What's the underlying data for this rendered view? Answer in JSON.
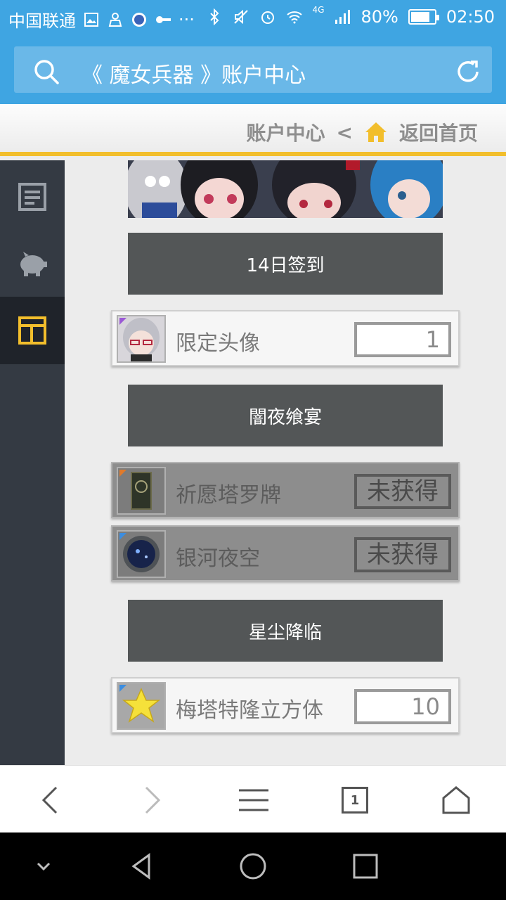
{
  "status_bar": {
    "carrier": "中国联通",
    "network": "4G",
    "battery_percent": "80%",
    "battery_level": 0.8,
    "time": "02:50"
  },
  "browser": {
    "page_title": "《 魔女兵器 》账户中心",
    "icons": [
      "search-icon",
      "refresh-icon"
    ]
  },
  "breadcrumb": {
    "current": "账户中心",
    "separator": "<",
    "home_label": "返回首页"
  },
  "sidebar": {
    "items": [
      {
        "icon": "document-icon",
        "active": false
      },
      {
        "icon": "piggy-bank-icon",
        "active": false
      },
      {
        "icon": "layout-icon",
        "active": true
      }
    ],
    "accent": "#f2be2c"
  },
  "sections": [
    {
      "title": "14日签到",
      "items": [
        {
          "name": "限定头像",
          "value": "1",
          "obtained": true,
          "icon": "avatar-portrait-icon"
        }
      ]
    },
    {
      "title": "闇夜飨宴",
      "items": [
        {
          "name": "祈愿塔罗牌",
          "value": "未获得",
          "obtained": false,
          "icon": "tarot-card-icon"
        },
        {
          "name": "银河夜空",
          "value": "未获得",
          "obtained": false,
          "icon": "galaxy-orb-icon"
        }
      ]
    },
    {
      "title": "星尘降临",
      "items": [
        {
          "name": "梅塔特隆立方体",
          "value": "10",
          "obtained": true,
          "icon": "star-cube-icon"
        }
      ]
    }
  ],
  "bottom_bar": {
    "tab_count": "1",
    "icons": [
      "back-icon",
      "forward-icon",
      "menu-icon",
      "tabs-icon",
      "home-icon"
    ]
  },
  "android_nav": {
    "icons": [
      "collapse-icon",
      "back-triangle-icon",
      "home-circle-icon",
      "recents-square-icon"
    ]
  },
  "colors": {
    "header_blue": "#3fa5e2",
    "sidebar_dark": "#343a43",
    "section_gray": "#535657",
    "accent_yellow": "#f2be2c"
  }
}
